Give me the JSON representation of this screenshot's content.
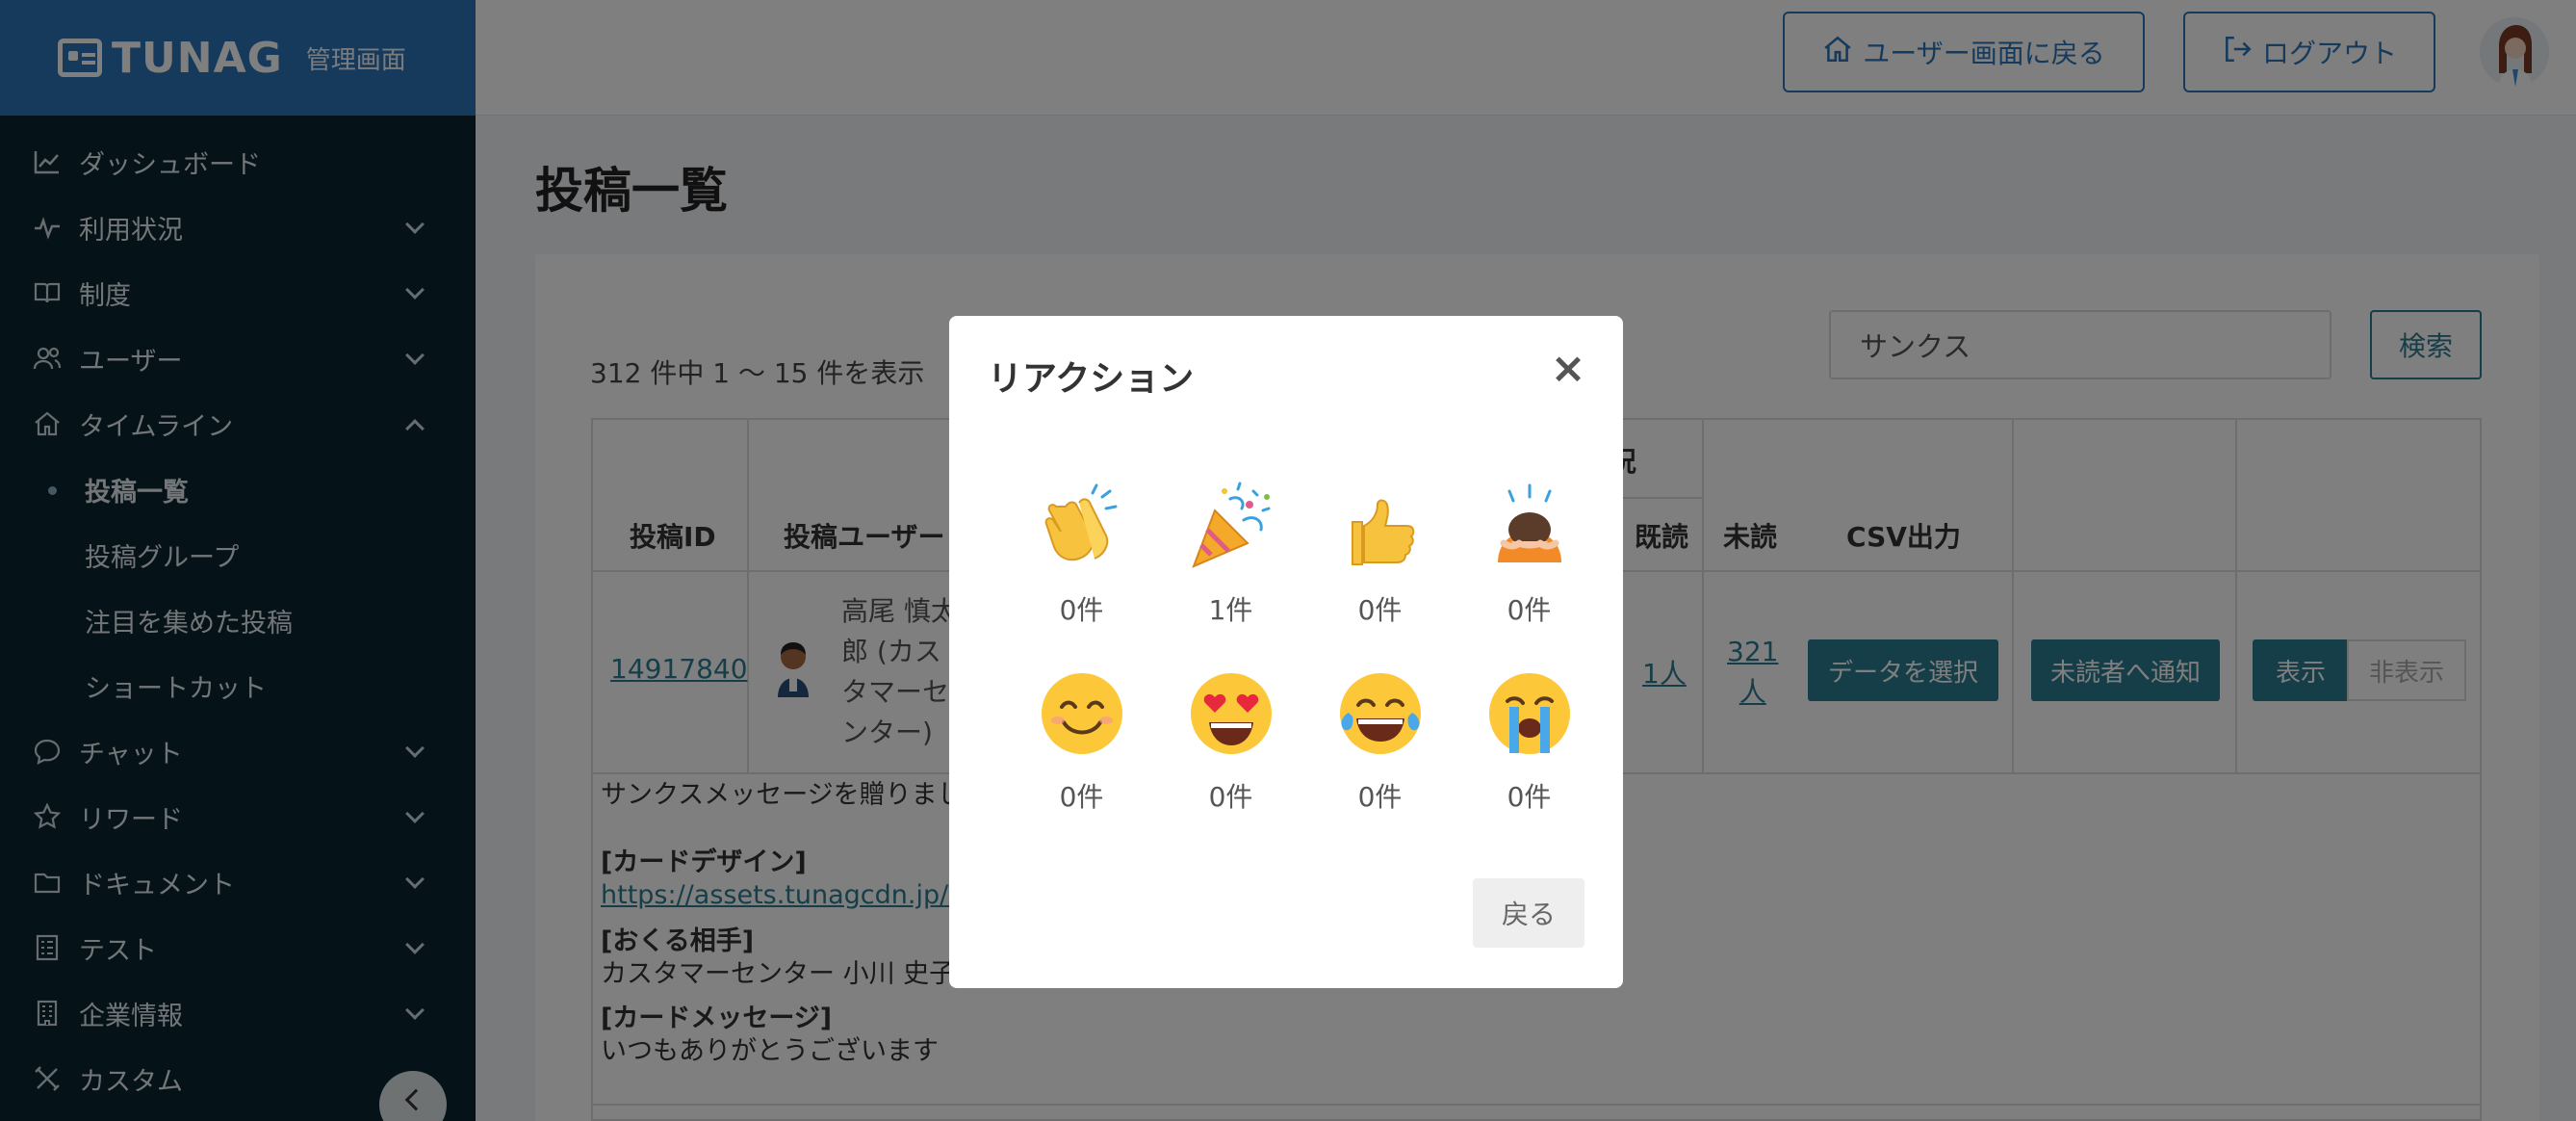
{
  "brand": {
    "logo_text": "TUNAG",
    "subtitle": "管理画面"
  },
  "sidebar": {
    "items": [
      {
        "label": "ダッシュボード",
        "icon": "chart-icon"
      },
      {
        "label": "利用状況",
        "icon": "activity-icon"
      },
      {
        "label": "制度",
        "icon": "book-icon"
      },
      {
        "label": "ユーザー",
        "icon": "users-icon"
      },
      {
        "label": "タイムライン",
        "icon": "home-icon"
      },
      {
        "label": "チャット",
        "icon": "chat-icon"
      },
      {
        "label": "リワード",
        "icon": "star-icon"
      },
      {
        "label": "ドキュメント",
        "icon": "folder-icon"
      },
      {
        "label": "テスト",
        "icon": "list-icon"
      },
      {
        "label": "企業情報",
        "icon": "building-icon"
      },
      {
        "label": "カスタム",
        "icon": "tools-icon"
      }
    ],
    "timeline_sub": [
      "投稿一覧",
      "投稿グループ",
      "注目を集めた投稿",
      "ショートカット"
    ]
  },
  "header": {
    "back_to_user": "ユーザー画面に戻る",
    "logout": "ログアウト"
  },
  "page": {
    "title": "投稿一覧",
    "count_text": "312 件中 1 〜 15 件を表示",
    "search_value": "サンクス",
    "search_button": "検索"
  },
  "table": {
    "headers": {
      "post_id": "投稿ID",
      "post_user": "投稿ユーザー",
      "read_status": "読状況",
      "read": "既読",
      "unread": "未読",
      "csv": "CSV出力"
    },
    "row": {
      "post_id": "14917840",
      "user_name_lines": [
        "高尾 慎太",
        "郎 (カス",
        "タマーセ",
        "ンター)"
      ],
      "read_count": "1人",
      "unread_count_lines": [
        "321",
        "人"
      ],
      "select_data": "データを選択",
      "notify_unread": "未読者へ通知",
      "show": "表示",
      "hide": "非表示"
    },
    "content": {
      "line1": "サンクスメッセージを贈りまし",
      "card_design_label": "[カードデザイン]",
      "card_design_url": "https://assets.tunagcdn.jp/as",
      "to_label": "[おくる相手]",
      "to_value": "カスタマーセンター 小川 史子",
      "message_label": "[カードメッセージ]",
      "message_value": "いつもありがとうございます"
    }
  },
  "modal": {
    "title": "リアクション",
    "close": "×",
    "back_button": "戻る",
    "reactions": [
      {
        "icon": "clapping-hands-icon",
        "count": "0件"
      },
      {
        "icon": "party-popper-icon",
        "count": "1件"
      },
      {
        "icon": "thumbs-up-icon",
        "count": "0件"
      },
      {
        "icon": "bowing-person-icon",
        "count": "0件"
      },
      {
        "icon": "smiling-face-icon",
        "count": "0件"
      },
      {
        "icon": "heart-eyes-icon",
        "count": "0件"
      },
      {
        "icon": "tears-of-joy-icon",
        "count": "0件"
      },
      {
        "icon": "crying-face-icon",
        "count": "0件"
      }
    ]
  },
  "colors": {
    "brand_blue": "#2b74b8",
    "sidebar_bg": "#0b2530",
    "teal": "#2d7d93"
  }
}
